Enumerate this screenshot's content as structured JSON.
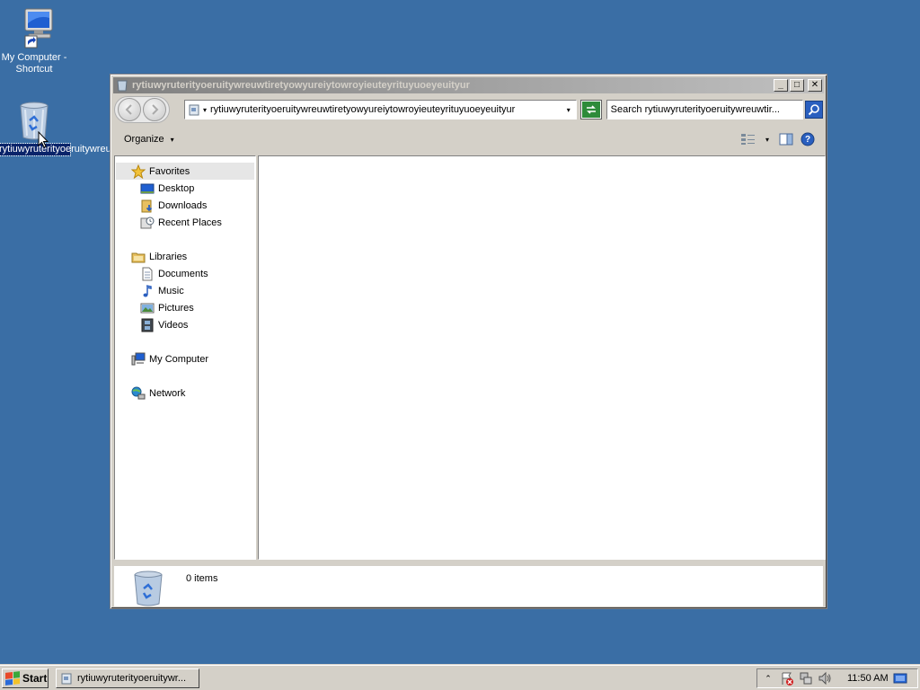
{
  "desktop": {
    "icons": [
      {
        "label": "My Computer - Shortcut",
        "icon": "computer-shortcut-icon"
      },
      {
        "label": "rytiuwyruterityoeruitywreuwtiretyowyureiytowroyieuteyrituyuoeyeuityur",
        "icon": "recycle-bin-icon",
        "selected": true
      }
    ],
    "background_color": "#3a6ea5"
  },
  "window": {
    "title": "rytiuwyruterityoeruitywreuwtiretyowyureiytowroyieuteyrituyuoeyeuityur",
    "controls": {
      "minimize": "_",
      "maximize": "□",
      "close": "✕"
    },
    "address": {
      "separator": "▾",
      "path": "rytiuwyruterityoeruitywreuwtiretyowyureiytowroyieuteyrituyuoeyeuityur",
      "dropdown": "▾"
    },
    "search": {
      "value": "Search rytiuwyruterityoeruitywreuwtir..."
    },
    "toolbar": {
      "organize_label": "Organize",
      "organize_caret": "▾",
      "views_caret": "▾",
      "help_label": "?"
    },
    "nav": {
      "favorites": {
        "label": "Favorites",
        "items": [
          "Desktop",
          "Downloads",
          "Recent Places"
        ]
      },
      "libraries": {
        "label": "Libraries",
        "items": [
          "Documents",
          "Music",
          "Pictures",
          "Videos"
        ]
      },
      "computer": {
        "label": "My Computer"
      },
      "network": {
        "label": "Network"
      }
    },
    "details": {
      "items_text": "0 items"
    }
  },
  "taskbar": {
    "start_label": "Start",
    "task_label": "rytiuwyruterityoeruitywr...",
    "tray": {
      "expand": "⌃",
      "clock": "11:50 AM"
    }
  }
}
